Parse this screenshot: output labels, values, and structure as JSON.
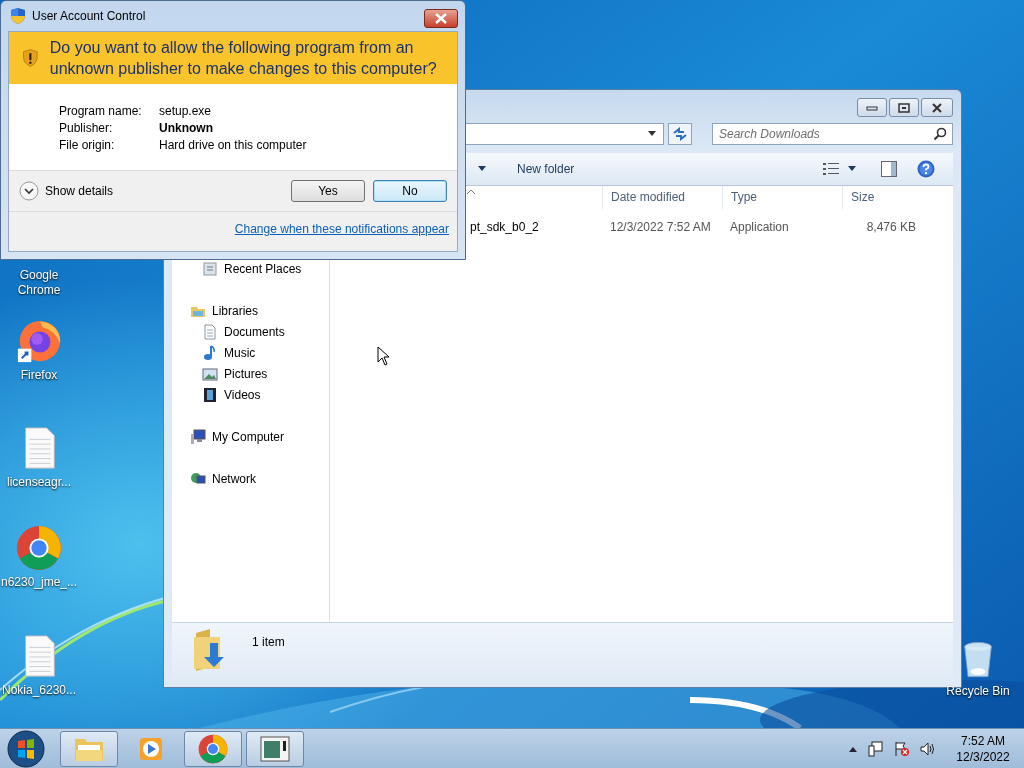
{
  "desktop_icons": [
    {
      "label": "Google Chrome",
      "kind": "covered"
    },
    {
      "label": "Firefox",
      "kind": "firefox"
    },
    {
      "label": "licenseagr...",
      "kind": "text"
    },
    {
      "label": "n6230_jme_...",
      "kind": "chrome"
    },
    {
      "label": "Nokia_6230...",
      "kind": "text"
    },
    {
      "label": "Recycle Bin",
      "kind": "recycle"
    }
  ],
  "explorer": {
    "search": {
      "placeholder": "Search Downloads"
    },
    "toolbar": [
      "New folder"
    ],
    "nav": [
      {
        "label": "Recent Places",
        "kind": "recent"
      },
      {
        "label": "Libraries",
        "kind": "library",
        "children": [
          {
            "label": "Documents",
            "kind": "document"
          },
          {
            "label": "Music",
            "kind": "music"
          },
          {
            "label": "Pictures",
            "kind": "pictures"
          },
          {
            "label": "Videos",
            "kind": "videos"
          }
        ]
      },
      {
        "label": "My Computer",
        "kind": "computer"
      },
      {
        "label": "Network",
        "kind": "network"
      }
    ],
    "columns": [
      "Date modified",
      "Type",
      "Size"
    ],
    "rows": [
      {
        "name": "pt_sdk_b0_2",
        "date": "12/3/2022 7:52 AM",
        "type": "Application",
        "size": "8,476 KB"
      }
    ],
    "status": "1 item"
  },
  "uac": {
    "title": "User Account Control",
    "question": "Do you want to allow the following program from an unknown publisher to make changes to this computer?",
    "fields": [
      {
        "label": "Program name:",
        "value": "setup.exe",
        "emphasis": false
      },
      {
        "label": "Publisher:",
        "value": "Unknown",
        "emphasis": true
      },
      {
        "label": "File origin:",
        "value": "Hard drive on this computer",
        "emphasis": false
      }
    ],
    "details": "Show details",
    "buttons": [
      {
        "label": "Yes",
        "focused": false
      },
      {
        "label": "No",
        "focused": true
      }
    ],
    "link": "Change when these notifications appear"
  },
  "taskbar": {
    "buttons": [
      {
        "kind": "explorer",
        "active": true
      },
      {
        "kind": "media",
        "active": false
      },
      {
        "kind": "chrome",
        "active": true
      },
      {
        "kind": "app",
        "active": true
      }
    ],
    "time": "7:52 AM",
    "date": "12/3/2022"
  }
}
